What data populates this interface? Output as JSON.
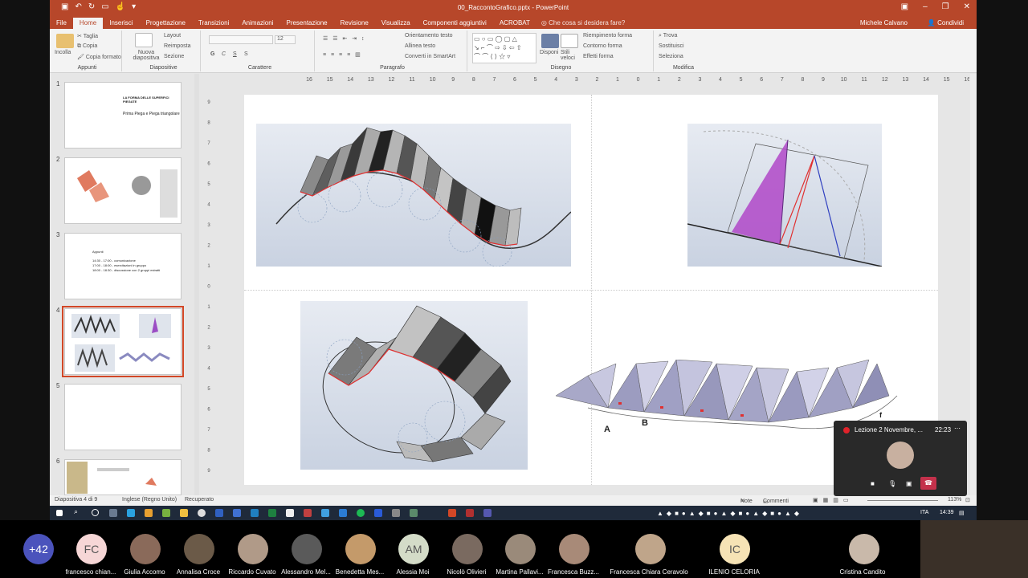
{
  "titlebar": {
    "filename": "00_RaccontoGrafico.pptx - PowerPoint"
  },
  "tabs": [
    "File",
    "Home",
    "Inserisci",
    "Progettazione",
    "Transizioni",
    "Animazioni",
    "Presentazione",
    "Revisione",
    "Visualizza",
    "Componenti aggiuntivi",
    "ACROBAT"
  ],
  "tell_me": "Che cosa si desidera fare?",
  "user": "Michele Calvano",
  "share": "Condividi",
  "ribbon": {
    "appunti": {
      "paste": "Incolla",
      "cut": "Taglia",
      "copy": "Copia",
      "format": "Copia formato",
      "label": "Appunti"
    },
    "diapositive": {
      "new": "Nuova diapositiva",
      "layout": "Layout",
      "reset": "Reimposta",
      "section": "Sezione",
      "label": "Diapositive"
    },
    "carattere": {
      "font_size": "12",
      "label": "Carattere",
      "format_icons": [
        "G",
        "C",
        "S",
        "S"
      ]
    },
    "paragrafo": {
      "dir": "Orientamento testo",
      "align": "Allinea testo",
      "smartart": "Converti in SmartArt",
      "label": "Paragrafo"
    },
    "disegno": {
      "arrange": "Disponi",
      "styles": "Stili veloci",
      "fill": "Riempimento forma",
      "outline": "Contorno forma",
      "effects": "Effetti forma",
      "label": "Disegno"
    },
    "modifica": {
      "find": "Trova",
      "replace": "Sostituisci",
      "select": "Seleziona",
      "label": "Modifica"
    }
  },
  "thumbnails": [
    {
      "n": "1",
      "lines": [
        "LA FORMA DELLE SUPERFICI PIEGATE",
        "Prima Piega e Piega triangolare"
      ]
    },
    {
      "n": "2",
      "lines": []
    },
    {
      "n": "3",
      "lines": [
        "Appunti",
        "14:30 - 17:00 - comunicazione",
        "17:00 - 18:00 - esercitazioni in gruppo",
        "18:00 - 18:30 - discussione con 2 gruppi estratti"
      ]
    },
    {
      "n": "4",
      "lines": []
    },
    {
      "n": "5",
      "lines": []
    },
    {
      "n": "6",
      "lines": []
    }
  ],
  "ruler": {
    "h": [
      "16",
      "15",
      "14",
      "13",
      "12",
      "11",
      "10",
      "9",
      "8",
      "7",
      "6",
      "5",
      "4",
      "3",
      "2",
      "1",
      "0",
      "1",
      "2",
      "3",
      "4",
      "5",
      "6",
      "7",
      "8",
      "9",
      "10",
      "11",
      "12",
      "13",
      "14",
      "15",
      "16"
    ],
    "v": [
      "9",
      "8",
      "7",
      "6",
      "5",
      "4",
      "3",
      "2",
      "1",
      "0",
      "1",
      "2",
      "3",
      "4",
      "5",
      "6",
      "7",
      "8",
      "9"
    ]
  },
  "slide": {
    "labels": [
      "A",
      "B",
      "f"
    ]
  },
  "status": {
    "slide_info": "Diapositiva 4 di 9",
    "lang": "Inglese (Regno Unito)",
    "recovered": "Recuperato",
    "notes": "Note",
    "comments": "Commenti",
    "zoom": "113%"
  },
  "taskbar": {
    "lang": "ITA",
    "time": "14:39"
  },
  "call": {
    "title": "Lezione 2 Novembre, ...",
    "timer": "22:23"
  },
  "participants": [
    {
      "initials": "+42",
      "name": "",
      "color": "#4b53bc"
    },
    {
      "initials": "FC",
      "name": "francesco chian...",
      "color": "#f6d6d6"
    },
    {
      "initials": "",
      "name": "Giulia Accomo",
      "color": "#8a6a5a"
    },
    {
      "initials": "",
      "name": "Annalisa Croce",
      "color": "#6b5a48"
    },
    {
      "initials": "",
      "name": "Riccardo Cuvato",
      "color": "#b09a88"
    },
    {
      "initials": "",
      "name": "Alessandro Mel...",
      "color": "#5a5a5a"
    },
    {
      "initials": "",
      "name": "Benedetta Mes...",
      "color": "#c49a6a"
    },
    {
      "initials": "AM",
      "name": "Alessia Moi",
      "color": "#d4dcc8"
    },
    {
      "initials": "",
      "name": "Nicolò Olivieri",
      "color": "#7a6a60"
    },
    {
      "initials": "",
      "name": "Martina Pallavi...",
      "color": "#9a8a7a"
    },
    {
      "initials": "",
      "name": "Francesca Buzz...",
      "color": "#a88a78"
    },
    {
      "initials": "",
      "name": "Francesca Chiara Ceravolo",
      "color": "#bfa58a"
    },
    {
      "initials": "IC",
      "name": "ILENIO CELORIA",
      "color": "#f6e3b5"
    },
    {
      "initials": "",
      "name": "Cristina Candito",
      "color": "#c9b9aa"
    }
  ]
}
